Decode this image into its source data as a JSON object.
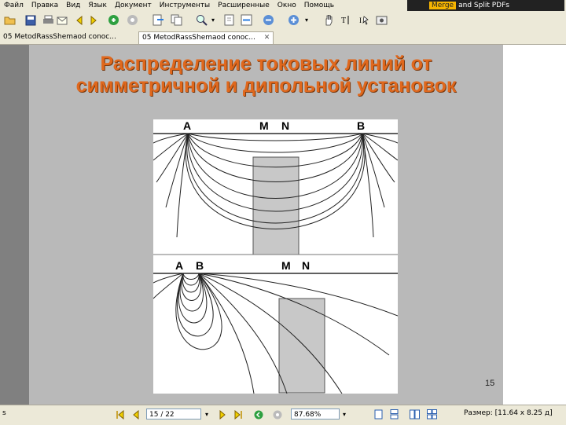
{
  "menu": {
    "items": [
      "Файл",
      "Правка",
      "Вид",
      "Язык",
      "Документ",
      "Инструменты",
      "Расширенные",
      "Окно",
      "Помощь"
    ]
  },
  "banner": {
    "merge": "Merge",
    "rest": "and Split PDFs"
  },
  "tabs": [
    {
      "label": "05 MetodRassShemaod conoc..."
    },
    {
      "label": "05 MetodRassShemaod conoc..."
    }
  ],
  "slide": {
    "title_line1": "Распределение токовых линий от",
    "title_line2": "симметричной и дипольной установок",
    "page_number": "15"
  },
  "figure": {
    "top": {
      "labels": [
        "A",
        "M",
        "N",
        "B"
      ]
    },
    "bottom": {
      "labels": [
        "A",
        "B",
        "M",
        "N"
      ]
    }
  },
  "status": {
    "page_field": "15 / 22",
    "zoom_field": "87.68%",
    "size_text": "Размер: [11.64 x 8.25 д]",
    "left_marker": "s"
  },
  "icons": [
    "open-icon",
    "save-icon",
    "print-icon",
    "email-icon",
    "back-icon",
    "forward-icon",
    "go-icon",
    "stop-icon",
    "export-icon",
    "copy-icon",
    "zoom-in-icon",
    "fit-page-icon",
    "fit-width-icon",
    "zoom-out-icon",
    "zoom-plus-icon",
    "hand-icon",
    "text-select-icon",
    "snapshot-icon"
  ]
}
